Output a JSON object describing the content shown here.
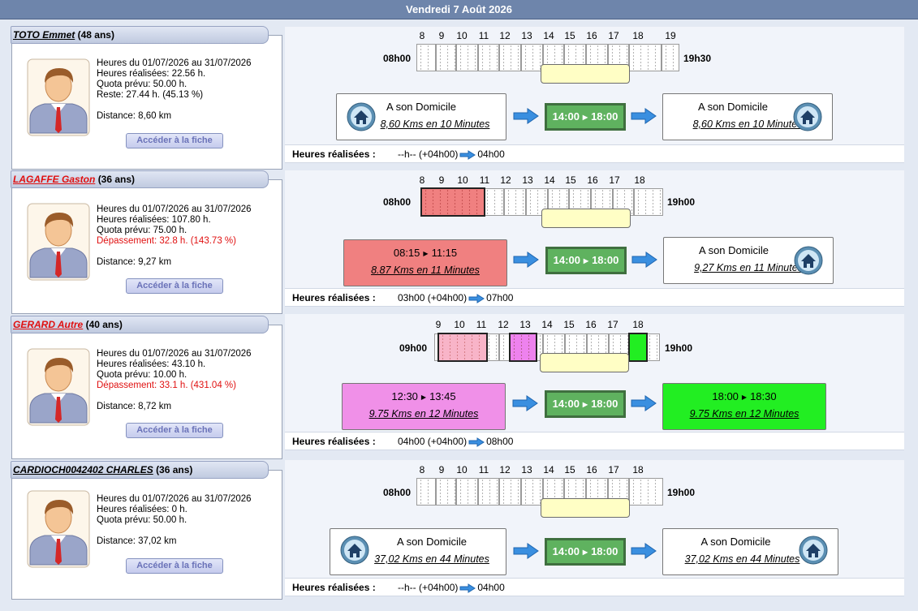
{
  "header": {
    "date": "Vendredi 7 Août 2026"
  },
  "colors": {
    "header": "#6e85ab",
    "lunch": "#5fb25f",
    "trip_red": "#f08080",
    "trip_pink": "#f090e8",
    "trip_green": "#22ee22",
    "arrow_blue": "#3a8fe0"
  },
  "icons": {
    "home": "home-icon",
    "arrow": "arrow-right-icon",
    "avatar": "person-avatar-icon"
  },
  "people": [
    {
      "name": "TOTO Emmet",
      "age": "(48 ans)",
      "name_red": false,
      "period": "Heures du 01/07/2026 au 31/07/2026",
      "done": "Heures réalisées: 22.56 h.",
      "quota": "Quota prévu: 50.00 h.",
      "rest": "Reste: 27.44 h. (45.13 %)",
      "rest_red": false,
      "distance": "Distance: 8,60 km",
      "button": "Accéder à la fiche",
      "start": "08h00",
      "end": "19h30",
      "hours": [
        "8",
        "9",
        "10",
        "11",
        "12",
        "13",
        "14",
        "15",
        "16",
        "17",
        "18",
        "19"
      ],
      "left": {
        "title": "A son Domicile",
        "sub": "8,60 Kms en 10 Minutes"
      },
      "lunch": {
        "from": "14:00",
        "to": "18:00"
      },
      "right": {
        "title": "A son Domicile",
        "sub": "8,60 Kms en 10 Minutes"
      },
      "realized_label": "Heures réalisées :",
      "realized_before": "--h-- (+04h00)",
      "realized_after": "04h00"
    },
    {
      "name": "LAGAFFE Gaston",
      "age": "(36 ans)",
      "name_red": true,
      "period": "Heures du 01/07/2026 au 31/07/2026",
      "done": "Heures réalisées: 107.80 h.",
      "quota": "Quota prévu: 75.00 h.",
      "rest": "Dépassement: 32.8 h. (143.73 %)",
      "rest_red": true,
      "distance": "Distance: 9,27 km",
      "button": "Accéder à la fiche",
      "start": "08h00",
      "end": "19h00",
      "hours": [
        "8",
        "9",
        "10",
        "11",
        "12",
        "13",
        "14",
        "15",
        "16",
        "17",
        "18"
      ],
      "left": {
        "from": "08:15",
        "to": "11:15",
        "sub": "8.87 Kms en 11 Minutes"
      },
      "lunch": {
        "from": "14:00",
        "to": "18:00"
      },
      "right": {
        "title": "A son Domicile",
        "sub": "9,27 Kms en 11 Minutes"
      },
      "realized_label": "Heures réalisées :",
      "realized_before": "03h00 (+04h00)",
      "realized_after": "07h00"
    },
    {
      "name": "GERARD Autre",
      "age": "(40 ans)",
      "name_red": true,
      "period": "Heures du 01/07/2026 au 31/07/2026",
      "done": "Heures réalisées: 43.10 h.",
      "quota": "Quota prévu: 10.00 h.",
      "rest": "Dépassement: 33.1 h. (431.04 %)",
      "rest_red": true,
      "distance": "Distance: 8,72 km",
      "button": "Accéder à la fiche",
      "start": "09h00",
      "end": "19h00",
      "hours": [
        "9",
        "10",
        "11",
        "12",
        "13",
        "14",
        "15",
        "16",
        "17",
        "18"
      ],
      "left": {
        "from": "12:30",
        "to": "13:45",
        "sub": "9.75 Kms en 12 Minutes"
      },
      "lunch": {
        "from": "14:00",
        "to": "18:00"
      },
      "right": {
        "from": "18:00",
        "to": "18:30",
        "sub": "9.75 Kms en 12 Minutes"
      },
      "realized_label": "Heures réalisées :",
      "realized_before": "04h00 (+04h00)",
      "realized_after": "08h00"
    },
    {
      "name": "CARDIOCH0042402 CHARLES",
      "age": "(36 ans)",
      "name_red": false,
      "period": "Heures du 01/07/2026 au 31/07/2026",
      "done": "Heures réalisées: 0 h.",
      "quota": "Quota prévu: 50.00 h.",
      "rest": "",
      "rest_red": false,
      "distance": "Distance: 37,02 km",
      "button": "Accéder à la fiche",
      "start": "08h00",
      "end": "19h00",
      "hours": [
        "8",
        "9",
        "10",
        "11",
        "12",
        "13",
        "14",
        "15",
        "16",
        "17",
        "18"
      ],
      "left": {
        "title": "A son Domicile",
        "sub": "37,02 Kms en 44 Minutes"
      },
      "lunch": {
        "from": "14:00",
        "to": "18:00"
      },
      "right": {
        "title": "A son Domicile",
        "sub": "37,02 Kms en 44 Minutes"
      },
      "realized_label": "Heures réalisées :",
      "realized_before": "--h-- (+04h00)",
      "realized_after": "04h00"
    }
  ]
}
